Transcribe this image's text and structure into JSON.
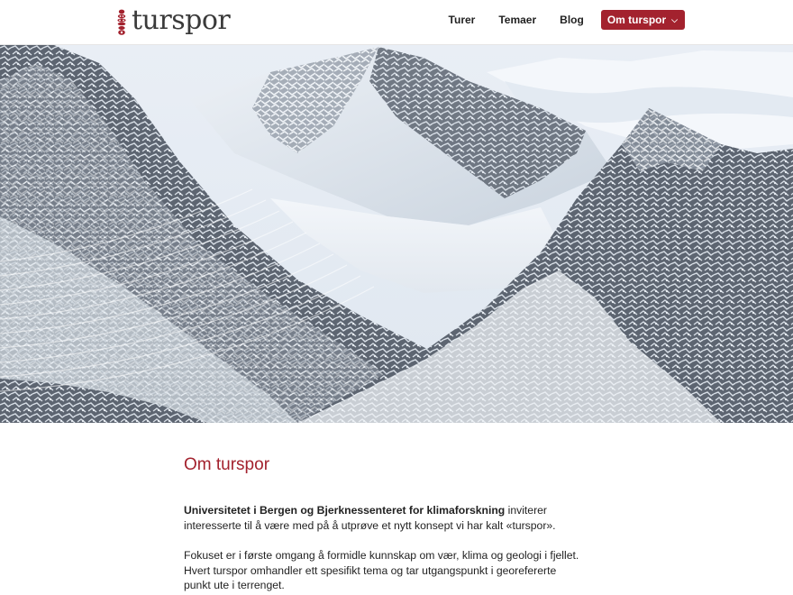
{
  "header": {
    "logo_text": "turspor",
    "nav": [
      {
        "label": "Turer"
      },
      {
        "label": "Temaer"
      },
      {
        "label": "Blog"
      },
      {
        "label": "Om turspor",
        "active": true
      }
    ],
    "accent_color": "#a3222e"
  },
  "hero": {
    "image": "snowy-mountain-landscape-with-contour-lines"
  },
  "main": {
    "title": "Om turspor",
    "paragraph1_bold": "Universitetet i Bergen og Bjerknessenteret for klimaforskning",
    "paragraph1_rest": " inviterer interesserte til å være med på å utprøve et nytt konsept vi har kalt «turspor».",
    "paragraph2": " Fokuset er i første omgang å formidle kunnskap om vær, klima og geologi i fjellet. Hvert turspor omhandler ett spesifikt tema og tar utgangspunkt i georefererte punkt ute i terrenget."
  }
}
